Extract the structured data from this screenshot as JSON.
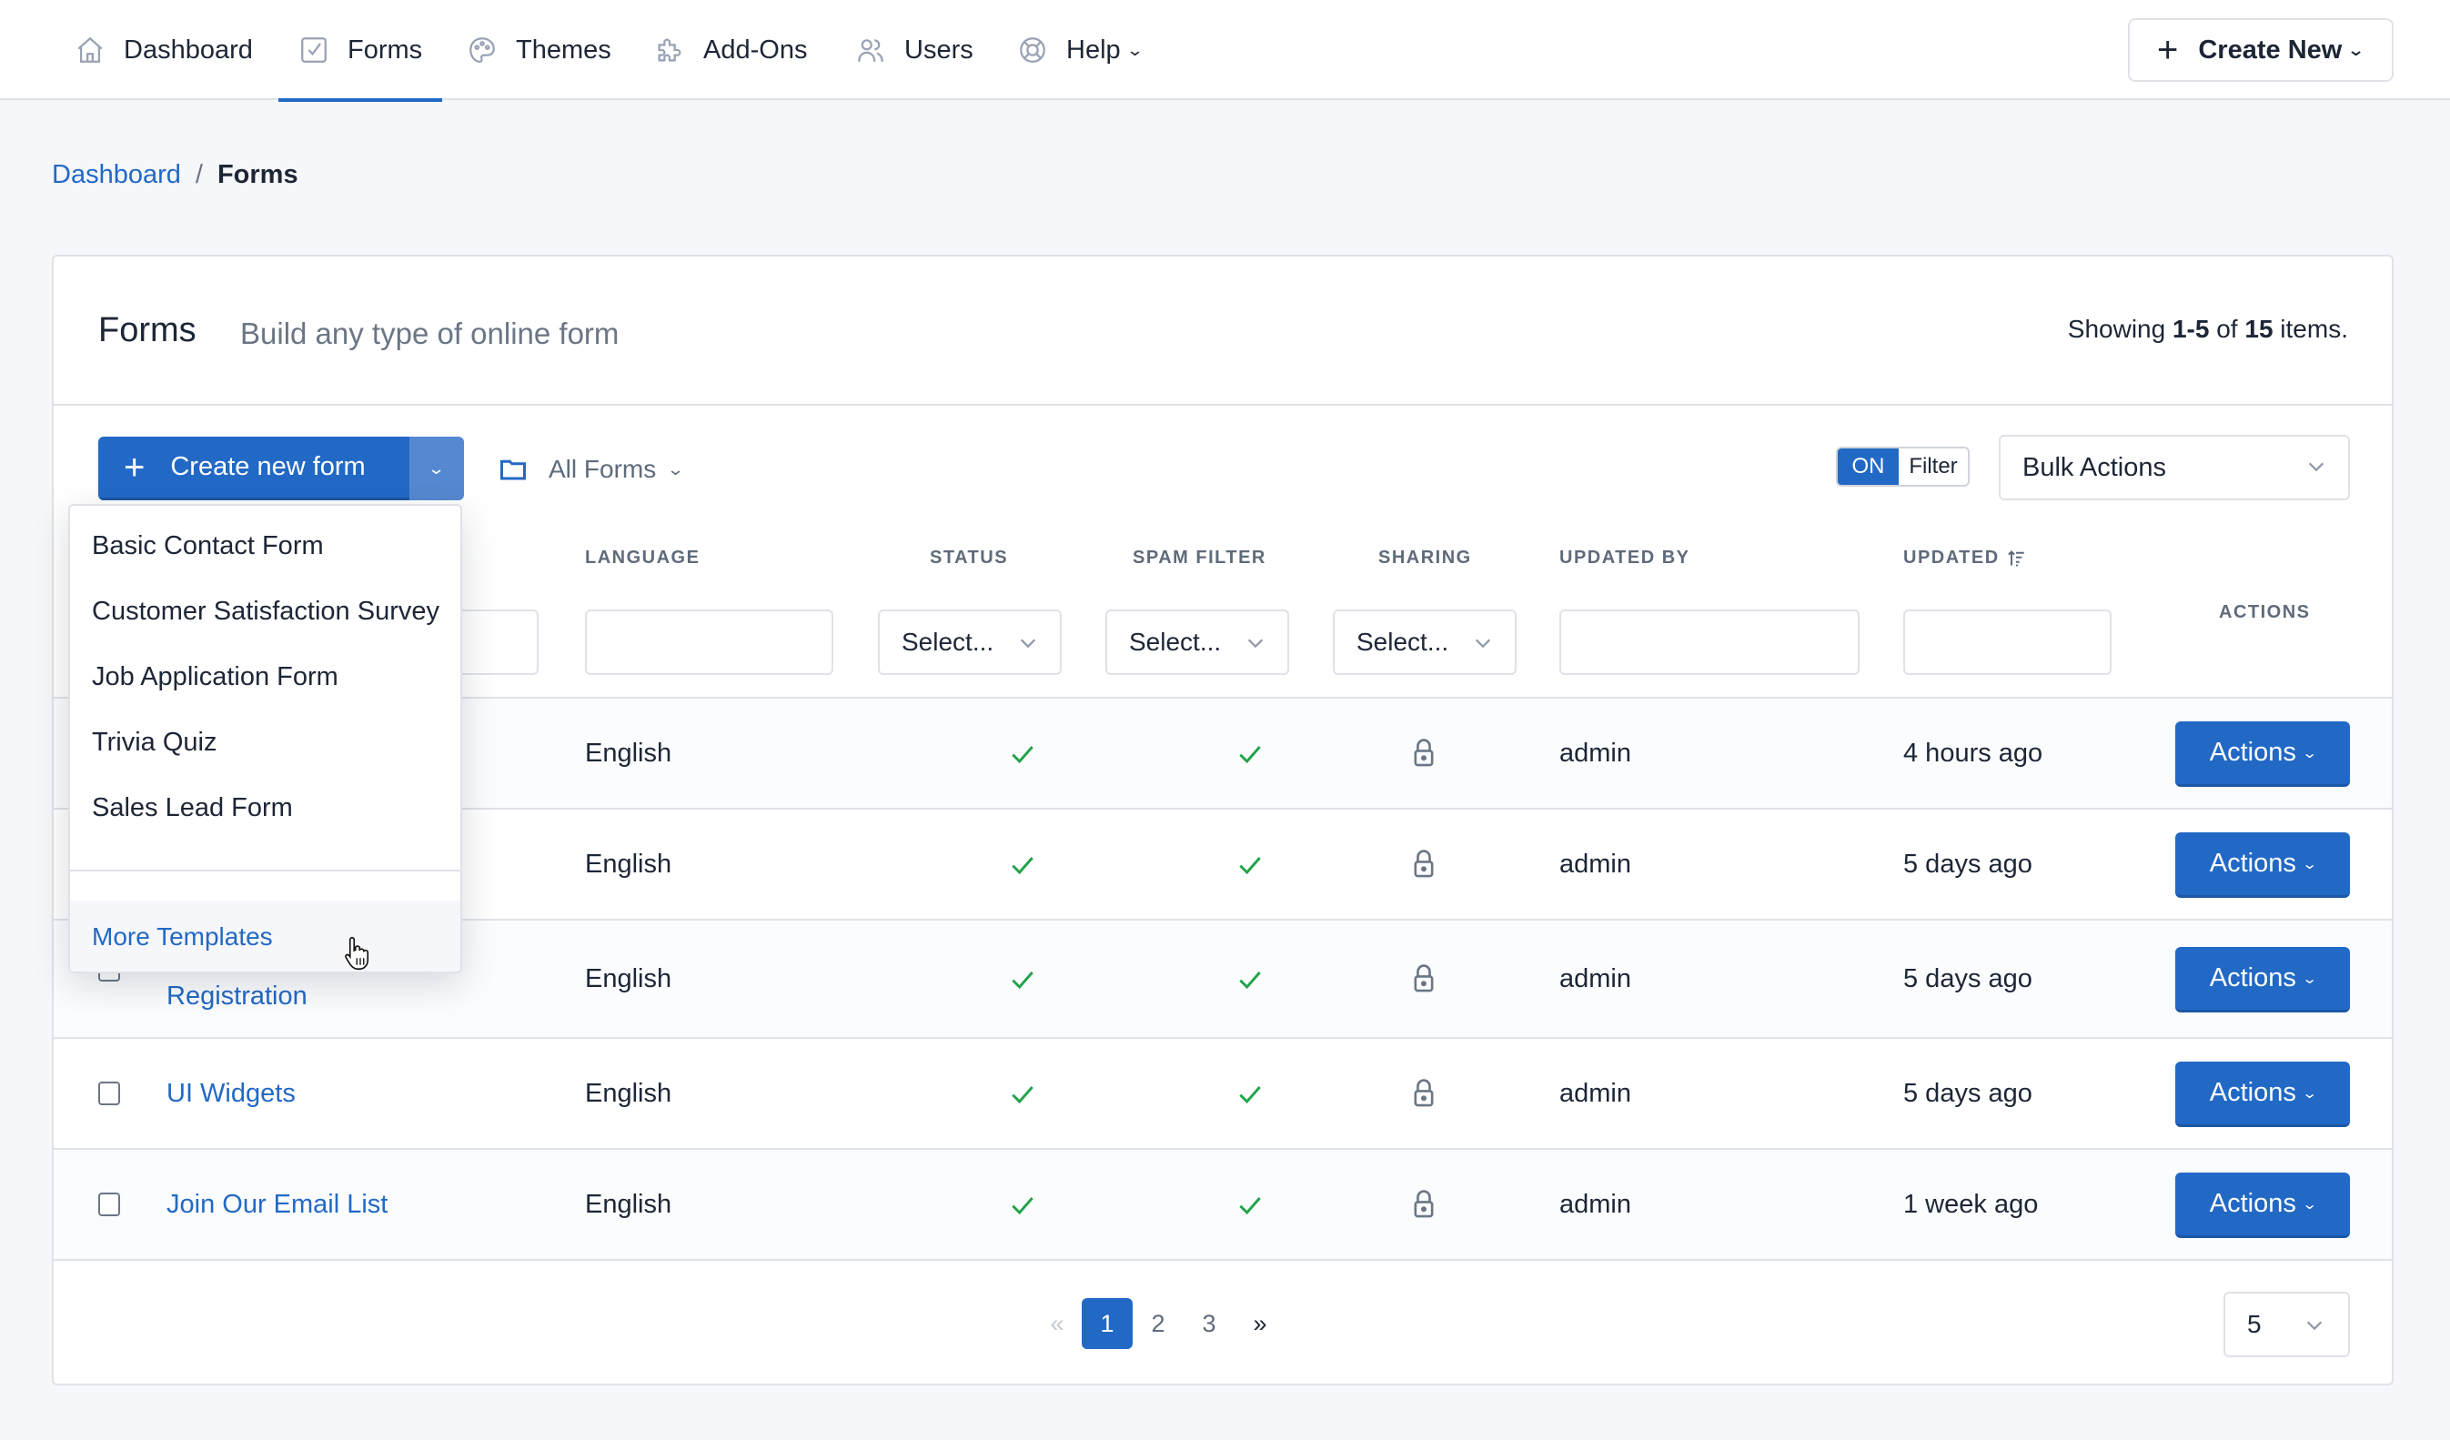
{
  "nav": {
    "items": [
      {
        "label": "Dashboard",
        "icon": "home-icon"
      },
      {
        "label": "Forms",
        "icon": "forms-check-icon",
        "active": true
      },
      {
        "label": "Themes",
        "icon": "palette-icon"
      },
      {
        "label": "Add-Ons",
        "icon": "puzzle-icon"
      },
      {
        "label": "Users",
        "icon": "users-icon"
      },
      {
        "label": "Help",
        "icon": "lifebuoy-icon",
        "has_dropdown": true
      }
    ],
    "create_new_label": "Create New"
  },
  "breadcrumb": {
    "parent": "Dashboard",
    "separator": "/",
    "current": "Forms"
  },
  "card": {
    "title": "Forms",
    "subtitle": "Build any type of online form",
    "showing": {
      "prefix": "Showing ",
      "range": "1-5",
      "middle": " of ",
      "total": "15",
      "suffix": " items."
    }
  },
  "toolbar": {
    "create_form_label": "Create new form",
    "folder_label": "All Forms",
    "filter_toggle_state": "ON",
    "filter_toggle_label": "Filter",
    "bulk_actions_label": "Bulk Actions"
  },
  "columns": {
    "language": "LANGUAGE",
    "status": "STATUS",
    "spam_filter": "SPAM FILTER",
    "sharing": "SHARING",
    "updated_by": "UPDATED BY",
    "updated": "UPDATED",
    "actions": "ACTIONS"
  },
  "filters": {
    "status_placeholder": "Select...",
    "spam_placeholder": "Select...",
    "sharing_placeholder": "Select..."
  },
  "rows": [
    {
      "name": "",
      "language": "English",
      "status": "active",
      "spam_filter": "on",
      "sharing": "locked",
      "updated_by": "admin",
      "updated": "4 hours ago",
      "action_label": "Actions"
    },
    {
      "name": "",
      "language": "English",
      "status": "active",
      "spam_filter": "on",
      "sharing": "locked",
      "updated_by": "admin",
      "updated": "5 days ago",
      "action_label": "Actions"
    },
    {
      "name": "Registration",
      "language": "English",
      "status": "active",
      "spam_filter": "on",
      "sharing": "locked",
      "updated_by": "admin",
      "updated": "5 days ago",
      "action_label": "Actions"
    },
    {
      "name": "UI Widgets",
      "language": "English",
      "status": "active",
      "spam_filter": "on",
      "sharing": "locked",
      "updated_by": "admin",
      "updated": "5 days ago",
      "action_label": "Actions"
    },
    {
      "name": "Join Our Email List",
      "language": "English",
      "status": "active",
      "spam_filter": "on",
      "sharing": "locked",
      "updated_by": "admin",
      "updated": "1 week ago",
      "action_label": "Actions"
    }
  ],
  "pagination": {
    "prev": "«",
    "pages": [
      "1",
      "2",
      "3"
    ],
    "current": "1",
    "next": "»",
    "page_size": "5"
  },
  "template_menu": {
    "items": [
      "Basic Contact Form",
      "Customer Satisfaction Survey",
      "Job Application Form",
      "Trivia Quiz",
      "Sales Lead Form"
    ],
    "more_label": "More Templates"
  },
  "colors": {
    "accent": "#2269c5",
    "success": "#22a34a",
    "text": "#1d2636",
    "muted": "#6b7685",
    "border": "#dfe2e8",
    "page_bg": "#f6f7fa"
  }
}
